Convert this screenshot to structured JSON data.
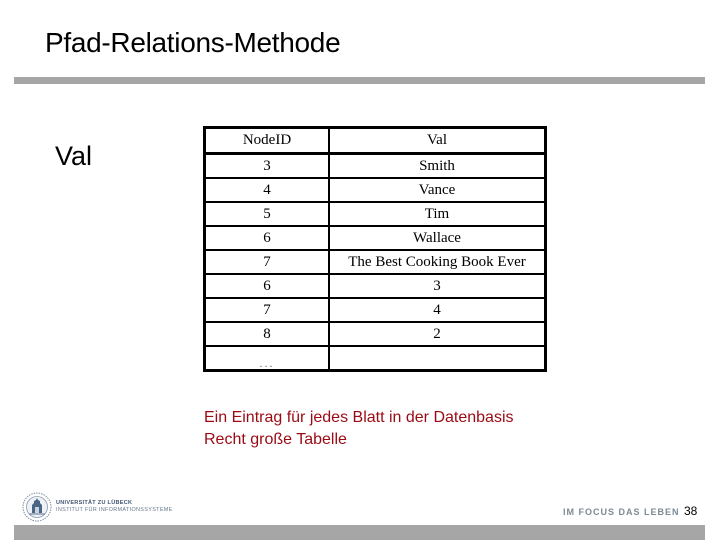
{
  "slide": {
    "title": "Pfad-Relations-Methode",
    "bullet_label": "Val"
  },
  "table": {
    "headers": [
      "NodeID",
      "Val"
    ],
    "rows": [
      [
        "3",
        "Smith"
      ],
      [
        "4",
        "Vance"
      ],
      [
        "5",
        "Tim"
      ],
      [
        "6",
        "Wallace"
      ],
      [
        "7",
        "The Best Cooking Book Ever"
      ],
      [
        "6",
        "3"
      ],
      [
        "7",
        "4"
      ],
      [
        "8",
        "2"
      ],
      [
        "...",
        ""
      ]
    ]
  },
  "notes": {
    "line1": "Ein Eintrag für jedes Blatt in der Datenbasis",
    "line2": "Recht große Tabelle",
    "color": "#9b0a14"
  },
  "footer": {
    "logo_icon": "university-seal-icon",
    "university": "UNIVERSITÄT ZU LÜBECK",
    "institute": "INSTITUT FÜR INFORMATIONSSYSTEME",
    "slogan": "IM FOCUS DAS LEBEN",
    "page_number": "38"
  }
}
